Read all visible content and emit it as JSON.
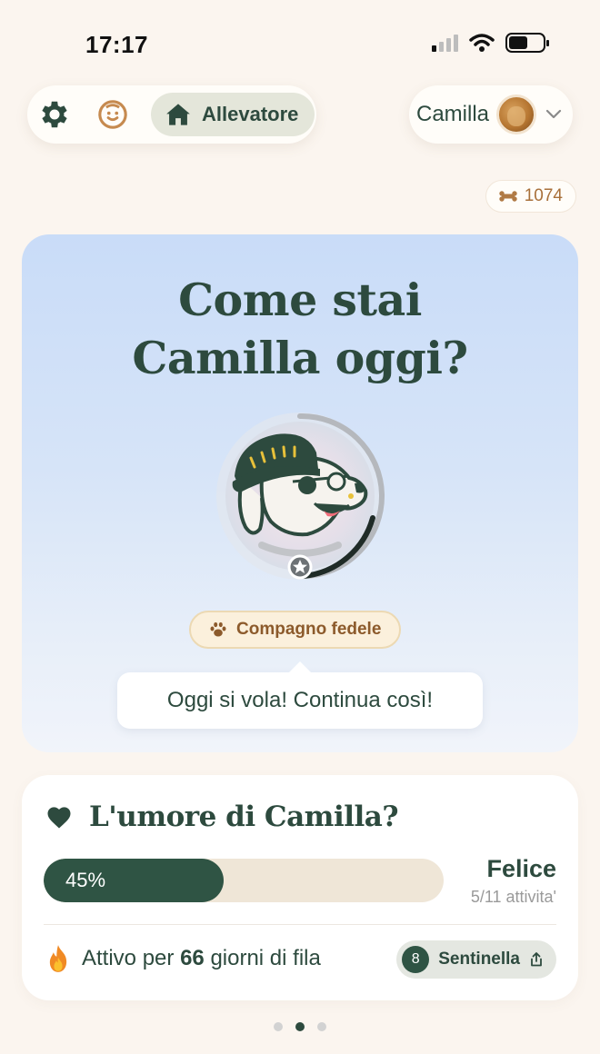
{
  "status_bar": {
    "time": "17:17"
  },
  "nav": {
    "settings_icon": "gear-icon",
    "profile_icon": "smiley-face-icon",
    "home": {
      "icon": "home-icon",
      "label": "Allevatore"
    },
    "user": {
      "name": "Camilla",
      "avatar": "dog-avatar",
      "chevron": "chevron-down-icon"
    }
  },
  "points": {
    "icon": "bone-icon",
    "value": "1074"
  },
  "hero": {
    "title_line1": "Come stai",
    "title_line2": "Camilla oggi?",
    "mascot": "dog-with-beanie-and-sunglasses",
    "badge": {
      "icon": "paw-icon",
      "label": "Compagno fedele"
    },
    "message": "Oggi si vola! Continua così!"
  },
  "mood": {
    "icon": "heart-icon",
    "title": "L'umore di Camilla?",
    "progress": {
      "value": 0.45,
      "label": "45%"
    },
    "status": "Felice",
    "count": "5/11 attivita'",
    "streak": {
      "icon": "fire-icon",
      "prefix": "Attivo per",
      "days": "66",
      "suffix": "giorni di fila"
    },
    "rank": {
      "number": "8",
      "label": "Sentinella",
      "icon": "share-icon"
    }
  },
  "pagination": {
    "pages": 3,
    "active": 2
  },
  "colors": {
    "primary": "#2d4a3e",
    "accent": "#a8703a",
    "background": "#fbf5ef",
    "hero_top": "#c9dcf8"
  }
}
